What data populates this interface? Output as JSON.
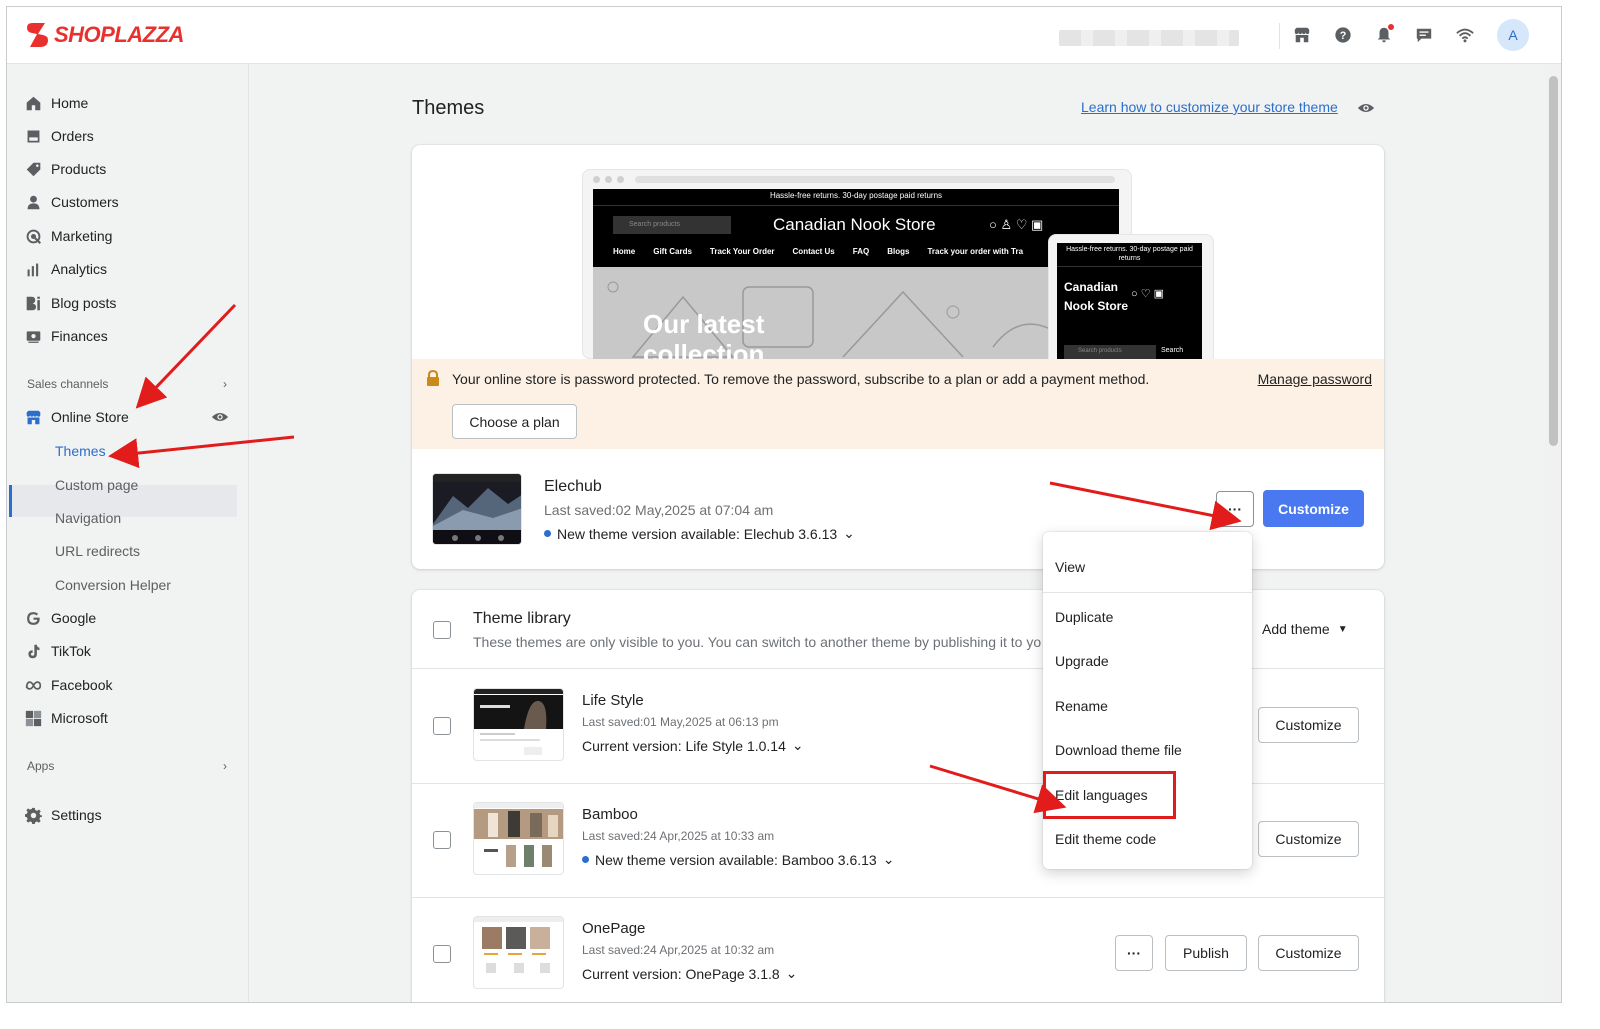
{
  "brand": {
    "name": "SHOPLAZZA",
    "color": "#e8312f"
  },
  "topbar": {
    "avatar_initial": "A",
    "icons": [
      "store-icon",
      "help-icon",
      "bell-icon",
      "chat-icon",
      "wifi-icon"
    ]
  },
  "sidebar": {
    "items": [
      {
        "label": "Home",
        "icon": "home-icon"
      },
      {
        "label": "Orders",
        "icon": "orders-icon"
      },
      {
        "label": "Products",
        "icon": "tag-icon"
      },
      {
        "label": "Customers",
        "icon": "person-icon"
      },
      {
        "label": "Marketing",
        "icon": "marketing-icon"
      },
      {
        "label": "Analytics",
        "icon": "analytics-icon"
      },
      {
        "label": "Blog posts",
        "icon": "blog-icon"
      },
      {
        "label": "Finances",
        "icon": "finances-icon"
      }
    ],
    "sales_channels_label": "Sales channels",
    "online_store_label": "Online Store",
    "sub_items": [
      "Themes",
      "Custom page",
      "Navigation",
      "URL redirects",
      "Conversion Helper"
    ],
    "channels": [
      {
        "label": "Google",
        "icon": "google-icon"
      },
      {
        "label": "TikTok",
        "icon": "tiktok-icon"
      },
      {
        "label": "Facebook",
        "icon": "meta-icon"
      },
      {
        "label": "Microsoft",
        "icon": "microsoft-icon"
      }
    ],
    "apps_label": "Apps",
    "settings_label": "Settings"
  },
  "page": {
    "title": "Themes",
    "learn_link": "Learn how to customize your store theme"
  },
  "preview": {
    "promo_text": "Hassle-free returns. 30-day postage paid returns",
    "search_placeholder": "Search products",
    "store_name": "Canadian Nook Store",
    "nav_links": [
      "Home",
      "Gift Cards",
      "Track Your Order",
      "Contact Us",
      "FAQ",
      "Blogs",
      "Track your order with Tra"
    ],
    "hero_text": "Our latest collection",
    "mobile_promo": "Hassle-free returns. 30-day postage paid returns",
    "mobile_store_name": "Canadian Nook Store",
    "mobile_search_placeholder": "Search products",
    "mobile_search_button": "Search"
  },
  "banner": {
    "text": "Your online store is password protected. To remove the password, subscribe to a plan or add a payment method.",
    "link": "Manage password",
    "button": "Choose a plan"
  },
  "current_theme": {
    "name": "Elechub",
    "last_saved": "Last saved:02 May,2025 at 07:04 am",
    "version_notice": "New theme version available: Elechub 3.6.13",
    "more_label": "···",
    "customize_label": "Customize"
  },
  "library": {
    "title": "Theme library",
    "description": "These themes are only visible to you. You can switch to another theme by publishing it to yo",
    "add_theme_label": "Add theme",
    "themes": [
      {
        "name": "Life Style",
        "last_saved": "Last saved:01 May,2025 at 06:13 pm",
        "version": "Current version: Life Style 1.0.14",
        "new_available": false,
        "customize_label": "Customize"
      },
      {
        "name": "Bamboo",
        "last_saved": "Last saved:24 Apr,2025 at 10:33 am",
        "version": "New theme version available: Bamboo 3.6.13",
        "new_available": true,
        "customize_label": "Customize"
      },
      {
        "name": "OnePage",
        "last_saved": "Last saved:24 Apr,2025 at 10:32 am",
        "version": "Current version: OnePage 3.1.8",
        "new_available": false,
        "more_label": "···",
        "publish_label": "Publish",
        "customize_label": "Customize"
      }
    ]
  },
  "dropdown_menu": {
    "items": [
      "View",
      "Duplicate",
      "Upgrade",
      "Rename",
      "Download theme file",
      "Edit languages",
      "Edit theme code"
    ],
    "highlighted": "Edit languages"
  },
  "colors": {
    "primary": "#4a78f0",
    "annotation_red": "#e21b1b",
    "link_blue": "#2c6ecb",
    "banner_bg": "#fdf1e6"
  }
}
